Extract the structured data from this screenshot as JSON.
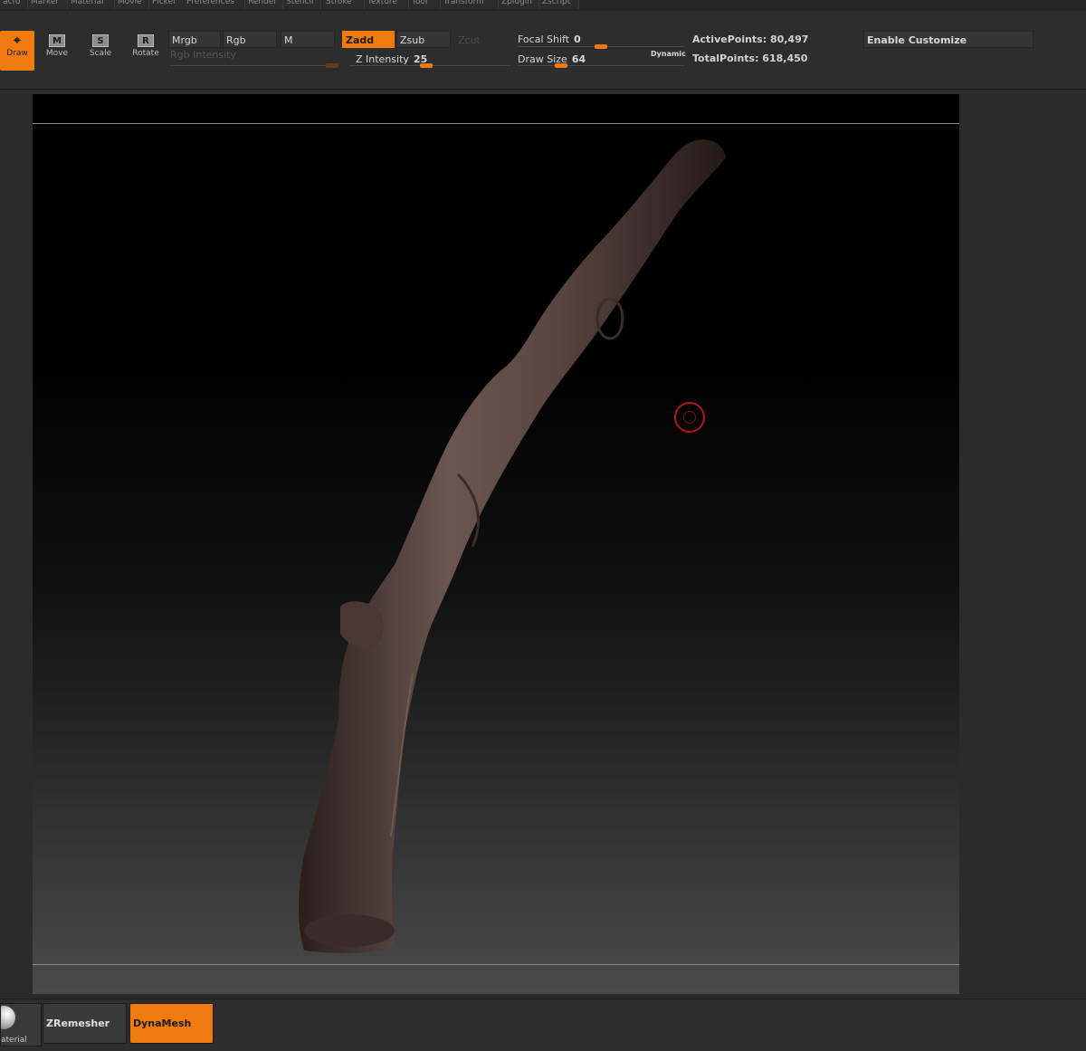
{
  "menu": [
    "acro",
    "Marker",
    "Material",
    "Movie",
    "Picker",
    "Preferences",
    "Render",
    "Stencil",
    "Stroke",
    "Texture",
    "Tool",
    "Transform",
    "Zplugin",
    "Zscript"
  ],
  "modes": {
    "draw": "Draw",
    "move": "Move",
    "scale": "Scale",
    "rotate": "Rotate",
    "move_glyph": "M",
    "scale_glyph": "S",
    "rotate_glyph": "R"
  },
  "channels": {
    "mrgb": "Mrgb",
    "rgb": "Rgb",
    "m": "M",
    "rgb_intensity": "Rgb  Intensity"
  },
  "sculpt": {
    "zadd": "Zadd",
    "zsub": "Zsub",
    "zcut": "Zcut",
    "z_intensity_label": "Z  Intensity",
    "z_intensity_value": "25"
  },
  "brush": {
    "focal_shift_label": "Focal  Shift",
    "focal_shift_value": "0",
    "draw_size_label": "Draw  Size",
    "draw_size_value": "64",
    "dynamic_label": "Dynamic"
  },
  "stats": {
    "active_points": "ActivePoints: 80,497",
    "total_points": "TotalPoints: 618,450"
  },
  "customize": "Enable  Customize",
  "bottom": {
    "material_label": "aterial",
    "zremesher": "ZRemesher",
    "dynamesh": "DynaMesh"
  },
  "colors": {
    "accent": "#f07a10",
    "cursor": "#b51414"
  }
}
